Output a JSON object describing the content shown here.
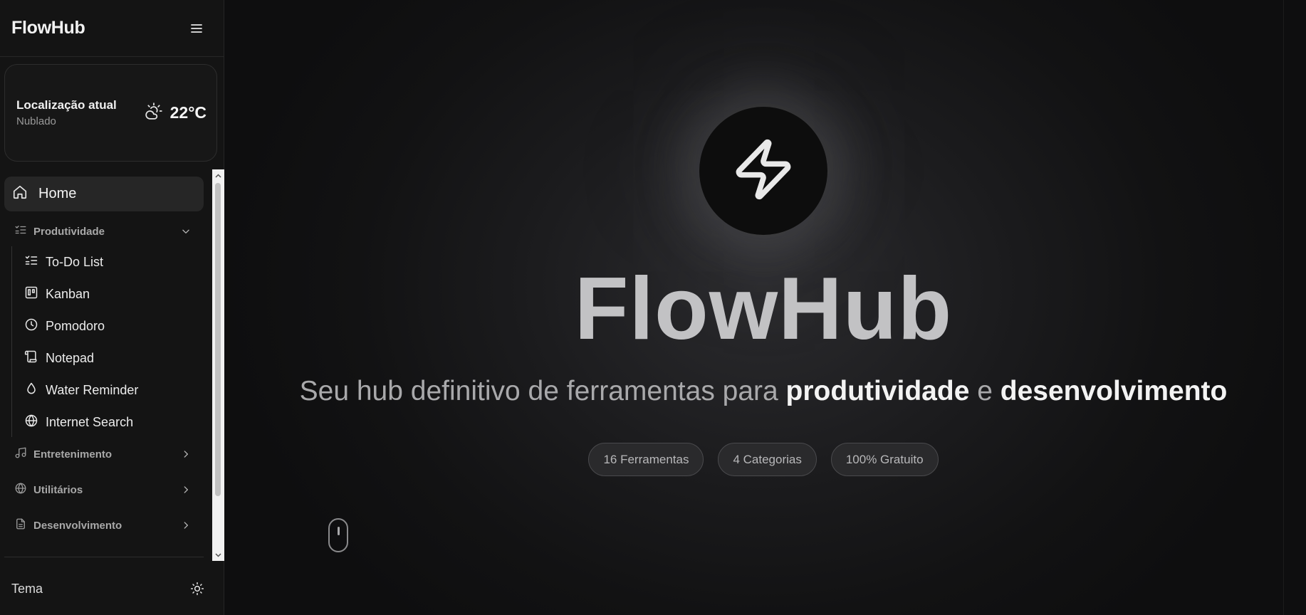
{
  "sidebar": {
    "brand": "FlowHub",
    "weather": {
      "location": "Localização atual",
      "condition": "Nublado",
      "temperature": "22°C",
      "icon": "partly-cloudy-icon"
    },
    "home": {
      "label": "Home",
      "icon": "home-icon"
    },
    "categories": [
      {
        "label": "Produtividade",
        "icon": "list-checks-icon",
        "expanded": true
      },
      {
        "label": "Entretenimento",
        "icon": "music-icon",
        "expanded": false
      },
      {
        "label": "Utilitários",
        "icon": "globe-icon",
        "expanded": false
      },
      {
        "label": "Desenvolvimento",
        "icon": "file-text-icon",
        "expanded": false
      }
    ],
    "items": [
      {
        "label": "To-Do List",
        "icon": "list-checks-icon"
      },
      {
        "label": "Kanban",
        "icon": "kanban-icon"
      },
      {
        "label": "Pomodoro",
        "icon": "clock-icon"
      },
      {
        "label": "Notepad",
        "icon": "scroll-icon"
      },
      {
        "label": "Water Reminder",
        "icon": "droplet-icon"
      },
      {
        "label": "Internet Search",
        "icon": "globe-icon"
      }
    ],
    "footer": {
      "theme_label": "Tema",
      "theme_icon": "sun-icon"
    }
  },
  "hero": {
    "title": "FlowHub",
    "subtitle_plain_1": "Seu hub definitivo de ferramentas para ",
    "subtitle_bold_1": "produtividade",
    "subtitle_plain_2": " e ",
    "subtitle_bold_2": "desenvolvimento",
    "pills": [
      "16 Ferramentas",
      "4 Categorias",
      "100% Gratuito"
    ],
    "logo_icon": "lightning-bolt-icon",
    "scroll_icon": "mouse-scroll-icon"
  }
}
